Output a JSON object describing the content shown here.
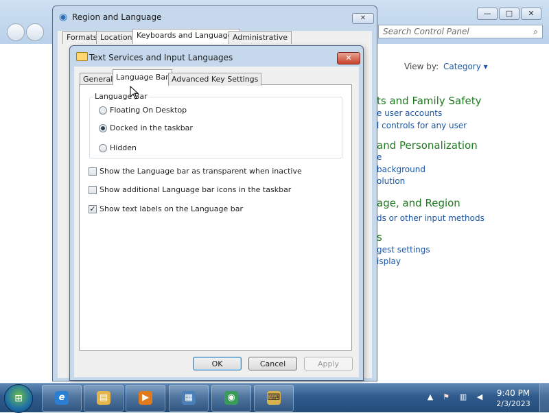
{
  "control_panel": {
    "search_placeholder": "Search Control Panel",
    "view_by_label": "View by:",
    "view_by_value": "Category",
    "headings": [
      "ts and Family Safety",
      "and Personalization",
      "age, and Region",
      "s"
    ],
    "links": [
      "e user accounts",
      "l controls for any user",
      "e",
      "background",
      "olution",
      "ds or other input methods",
      "gest settings",
      "isplay"
    ],
    "window_buttons": {
      "minimize": "—",
      "maximize": "□",
      "close": "✕"
    }
  },
  "region_dialog": {
    "title": "Region and Language",
    "close_glyph": "✕",
    "tabs": [
      "Formats",
      "Location",
      "Keyboards and Languages",
      "Administrative"
    ]
  },
  "text_services_dialog": {
    "title": "Text Services and Input Languages",
    "close_glyph": "✕",
    "tabs": [
      "General",
      "Language Bar",
      "Advanced Key Settings"
    ],
    "group_label": "Language Bar",
    "radios": [
      {
        "label": "Floating On Desktop",
        "checked": false
      },
      {
        "label": "Docked in the taskbar",
        "checked": true
      },
      {
        "label": "Hidden",
        "checked": false
      }
    ],
    "checkboxes": [
      {
        "label": "Show the Language bar as transparent when inactive",
        "checked": false
      },
      {
        "label": "Show additional Language bar icons in the taskbar",
        "checked": false
      },
      {
        "label": "Show text labels on the Language bar",
        "checked": true
      }
    ],
    "buttons": {
      "ok": "OK",
      "cancel": "Cancel",
      "apply": "Apply"
    }
  },
  "taskbar": {
    "start_glyph": "⊞",
    "apps": [
      {
        "name": "internet-explorer",
        "glyph": "e"
      },
      {
        "name": "file-explorer",
        "glyph": "▤"
      },
      {
        "name": "media-player",
        "glyph": "▶"
      },
      {
        "name": "control-panel",
        "glyph": "▦"
      },
      {
        "name": "region-globe",
        "glyph": "◉"
      },
      {
        "name": "keyboard",
        "glyph": "⌨"
      }
    ],
    "tray": {
      "up_arrow": "▲",
      "flag": "⚑",
      "network": "▥",
      "volume": "◀"
    },
    "clock": {
      "time": "9:40 PM",
      "date": "2/3/2023"
    }
  },
  "colors": {
    "link": "#1a56a8",
    "heading_green": "#1e7a1e",
    "close_red": "#c8412b",
    "taskbar": "#2f5b8c"
  }
}
